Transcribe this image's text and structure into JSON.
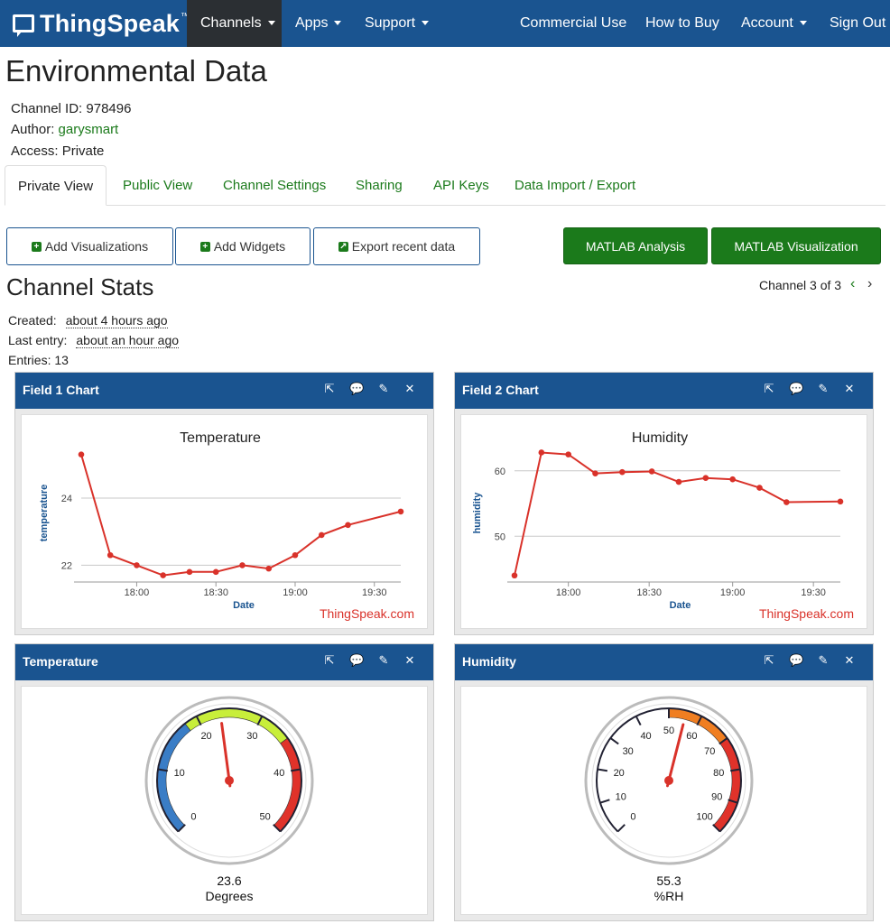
{
  "nav": {
    "brand": "ThingSpeak",
    "brand_tm": "™",
    "channels": "Channels",
    "apps": "Apps",
    "support": "Support",
    "commercial": "Commercial Use",
    "how_to_buy": "How to Buy",
    "account": "Account",
    "sign_out": "Sign Out"
  },
  "channel": {
    "title": "Environmental Data",
    "id_label": "Channel ID:",
    "id_value": "978496",
    "author_label": "Author:",
    "author_value": "garysmart",
    "access_label": "Access:",
    "access_value": "Private"
  },
  "tabs": [
    "Private View",
    "Public View",
    "Channel Settings",
    "Sharing",
    "API Keys",
    "Data Import / Export"
  ],
  "buttons": {
    "add_vis": "Add Visualizations",
    "add_widgets": "Add Widgets",
    "export": "Export recent data",
    "matlab_analysis": "MATLAB Analysis",
    "matlab_vis": "MATLAB Visualization"
  },
  "stats": {
    "title": "Channel Stats",
    "pager": "Channel 3 of 3",
    "created_label": "Created:",
    "created_value": "about 4 hours ago",
    "last_label": "Last entry:",
    "last_value": "about an hour ago",
    "entries": "Entries: 13"
  },
  "colors": {
    "nav": "#1a5490",
    "accent_green": "#1b7a1b",
    "series": "#d9322a"
  },
  "widgets": {
    "field1": {
      "header": "Field 1 Chart"
    },
    "field2": {
      "header": "Field 2 Chart"
    },
    "temp_gauge": {
      "header": "Temperature"
    },
    "hum_gauge": {
      "header": "Humidity"
    },
    "credit": "ThingSpeak.com"
  },
  "chart_data": [
    {
      "type": "line",
      "title": "Temperature",
      "xlabel": "Date",
      "ylabel": "temperature",
      "x": [
        "17:36",
        "17:44",
        "17:52",
        "18:00",
        "18:08",
        "18:16",
        "18:24",
        "18:32",
        "18:40",
        "18:48",
        "18:56",
        "19:04",
        "19:12",
        "19:44"
      ],
      "xticks": [
        "18:00",
        "18:30",
        "19:00",
        "19:30"
      ],
      "yticks": [
        22,
        24
      ],
      "ylim": [
        21.5,
        25.4
      ],
      "series": [
        {
          "values": [
            25.3,
            22.3,
            22.0,
            21.7,
            21.8,
            21.8,
            22.0,
            21.9,
            22.3,
            22.9,
            23.2,
            23.6
          ]
        }
      ],
      "x_minutes": [
        0,
        11,
        21,
        31,
        41,
        51,
        61,
        71,
        81,
        91,
        101,
        121
      ]
    },
    {
      "type": "line",
      "title": "Humidity",
      "xlabel": "Date",
      "ylabel": "humidity",
      "xticks": [
        "18:00",
        "18:30",
        "19:00",
        "19:30"
      ],
      "yticks": [
        50,
        60
      ],
      "ylim": [
        43,
        63
      ],
      "series": [
        {
          "values": [
            44.0,
            62.8,
            62.5,
            59.6,
            59.8,
            59.9,
            58.3,
            58.9,
            58.7,
            57.4,
            55.2,
            55.3
          ]
        }
      ],
      "x_minutes": [
        0,
        10,
        20,
        30,
        40,
        51,
        61,
        71,
        81,
        91,
        101,
        121
      ]
    },
    {
      "type": "gauge",
      "title": "Temperature",
      "value": 23.6,
      "value_text": "23.6",
      "units": "Degrees",
      "min": 0,
      "max": 50,
      "ticks": [
        0,
        10,
        20,
        30,
        40,
        50
      ],
      "bands": [
        {
          "from": 0,
          "to": 18,
          "color": "#3a7dc6"
        },
        {
          "from": 18,
          "to": 35,
          "color": "#c8ee3a"
        },
        {
          "from": 35,
          "to": 50,
          "color": "#e0322a"
        }
      ]
    },
    {
      "type": "gauge",
      "title": "Humidity",
      "value": 55.3,
      "value_text": "55.3",
      "units": "%RH",
      "min": 0,
      "max": 100,
      "ticks": [
        0,
        10,
        20,
        30,
        40,
        50,
        60,
        70,
        80,
        90,
        100
      ],
      "bands": [
        {
          "from": 50,
          "to": 70,
          "color": "#f07e21"
        },
        {
          "from": 70,
          "to": 100,
          "color": "#e0322a"
        }
      ]
    }
  ]
}
